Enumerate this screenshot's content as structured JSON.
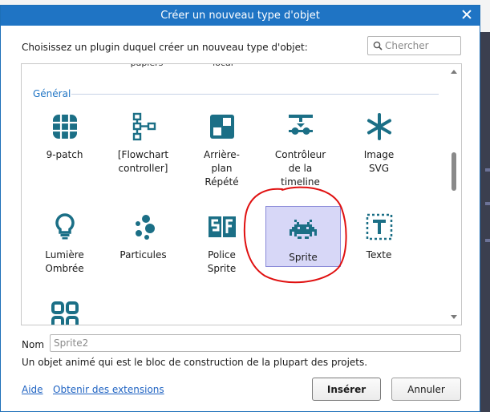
{
  "window": {
    "title": "Créer un nouveau type d'objet"
  },
  "prompt": "Choisissez un plugin duquel créer un nouveau type d'objet:",
  "search": {
    "placeholder": "Chercher"
  },
  "list": {
    "cut_labels": [
      "papiers",
      "local"
    ],
    "section": "Général",
    "tiles": [
      {
        "label": "9-patch",
        "icon": "nine-patch-icon"
      },
      {
        "label": "[Flowchart\ncontroller]",
        "icon": "flowchart-icon"
      },
      {
        "label": "Arrière-\nplan\nRépété",
        "icon": "tiled-background-icon"
      },
      {
        "label": "Contrôleur\nde la\ntimeline",
        "icon": "timeline-icon"
      },
      {
        "label": "Image\nSVG",
        "icon": "asterisk-icon"
      },
      {
        "label": "Lumière\nOmbrée",
        "icon": "lightbulb-icon"
      },
      {
        "label": "Particules",
        "icon": "particles-icon"
      },
      {
        "label": "Police\nSprite",
        "icon": "sprite-font-icon"
      },
      {
        "label": "Sprite",
        "icon": "space-invader-icon",
        "selected": true
      },
      {
        "label": "Texte",
        "icon": "text-icon"
      },
      {
        "label": "",
        "icon": "grid-icon"
      }
    ]
  },
  "name": {
    "label": "Nom",
    "placeholder": "Sprite2"
  },
  "description": "Un objet animé qui est le bloc de construction de la plupart des projets.",
  "links": {
    "help": "Aide",
    "extensions": "Obtenir des extensions"
  },
  "buttons": {
    "insert": "Insérer",
    "cancel": "Annuler"
  },
  "colors": {
    "accent": "#1f74c4",
    "icon": "#1b6f86",
    "selection": "#d7d7f7",
    "annotation": "#e01010"
  }
}
